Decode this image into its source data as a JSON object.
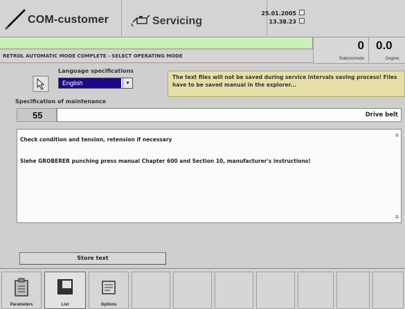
{
  "header": {
    "app_title": "COM-customer",
    "mode_title": "Servicing",
    "date": "25.01.2005",
    "time": "13.38.23"
  },
  "status": {
    "message": "RETROL AUTOMATIC MODE COMPLETE - SELECT OPERATING MODE",
    "status_bar_color": "#c8f0b8"
  },
  "counters": [
    {
      "value": "0",
      "label": "Stationsmode"
    },
    {
      "value": "0.0",
      "label": "Degree"
    }
  ],
  "language": {
    "label": "Language specifications",
    "value": "English",
    "arrow": "▾"
  },
  "info_text": "The text files will not be saved during service intervals saving process! Files have to be saved manual in the explorer...",
  "specification": {
    "label": "Specification of maintenance",
    "number": "55",
    "title": "Drive belt"
  },
  "text_area": {
    "lines": [
      "Check condition and tension, retension if necessary",
      "Siehe GROBERER punching press manual Chapter 600 and Section 10, manufacturer's instructions!"
    ]
  },
  "buttons": {
    "save_text": "Store text"
  },
  "toolbar": {
    "buttons": [
      {
        "label": "Parameters",
        "icon": "clipboard-icon"
      },
      {
        "label": "List",
        "icon": "list-window-icon"
      },
      {
        "label": "Options",
        "icon": "options-icon"
      }
    ]
  },
  "colors": {
    "selection_blue": "#1a0a8a",
    "info_yellow": "#e6e0a8"
  }
}
